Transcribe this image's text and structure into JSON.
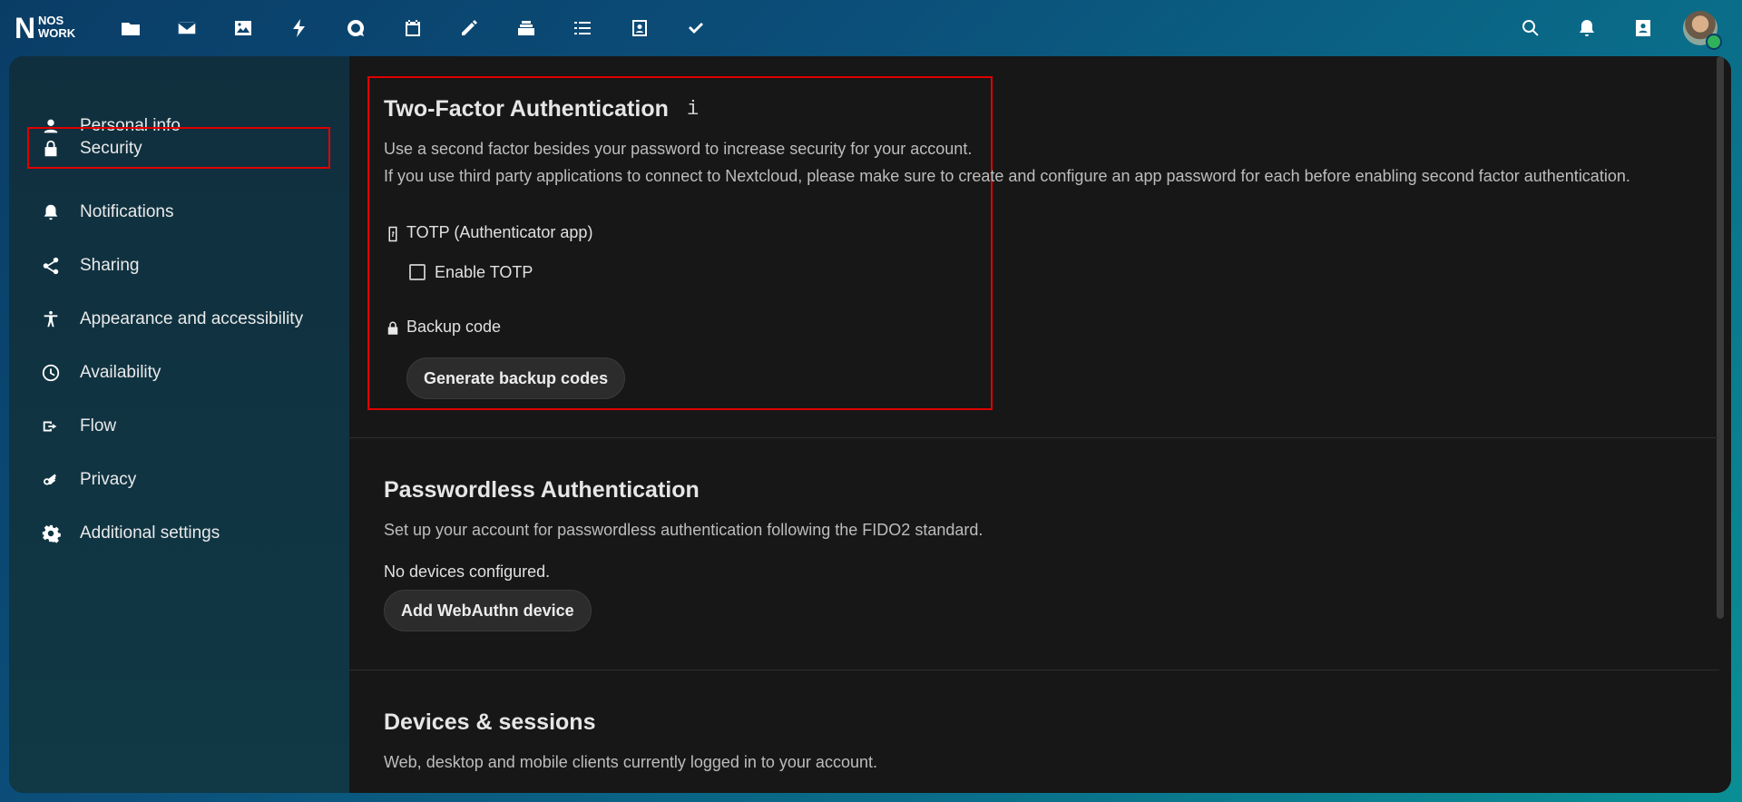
{
  "brand": {
    "logo_top": "NOS",
    "logo_bottom": "WORK"
  },
  "topbar": {
    "apps": [
      "files-icon",
      "mail-icon",
      "photos-icon",
      "activity-icon",
      "talk-icon",
      "calendar-icon",
      "notes-icon",
      "deck-icon",
      "tasks-icon",
      "contacts-app-icon",
      "checkmark-icon"
    ],
    "right": [
      "search-icon",
      "notifications-icon",
      "contacts-icon"
    ]
  },
  "sidebar": {
    "items": [
      {
        "label": "Personal info",
        "icon": "person-icon"
      },
      {
        "label": "Security",
        "icon": "lock-icon"
      },
      {
        "label": "Notifications",
        "icon": "bell-icon"
      },
      {
        "label": "Sharing",
        "icon": "share-icon"
      },
      {
        "label": "Appearance and accessibility",
        "icon": "accessibility-icon"
      },
      {
        "label": "Availability",
        "icon": "clock-icon"
      },
      {
        "label": "Flow",
        "icon": "flow-icon"
      },
      {
        "label": "Privacy",
        "icon": "key-icon"
      },
      {
        "label": "Additional settings",
        "icon": "gear-icon"
      }
    ],
    "active": "Security"
  },
  "twofactor": {
    "title": "Two-Factor Authentication",
    "info": "i",
    "desc1": "Use a second factor besides your password to increase security for your account.",
    "desc2": "If you use third party applications to connect to Nextcloud, please make sure to create and configure an app password for each before enabling second factor authentication.",
    "totp_label": "TOTP (Authenticator app)",
    "enable_totp": "Enable TOTP",
    "backup_label": "Backup code",
    "backup_button": "Generate backup codes"
  },
  "passwordless": {
    "title": "Passwordless Authentication",
    "desc": "Set up your account for passwordless authentication following the FIDO2 standard.",
    "status": "No devices configured.",
    "button": "Add WebAuthn device"
  },
  "devices": {
    "title": "Devices & sessions",
    "desc": "Web, desktop and mobile clients currently logged in to your account."
  },
  "colors": {
    "highlight": "#e00000",
    "accent": "#0a6f8a"
  }
}
